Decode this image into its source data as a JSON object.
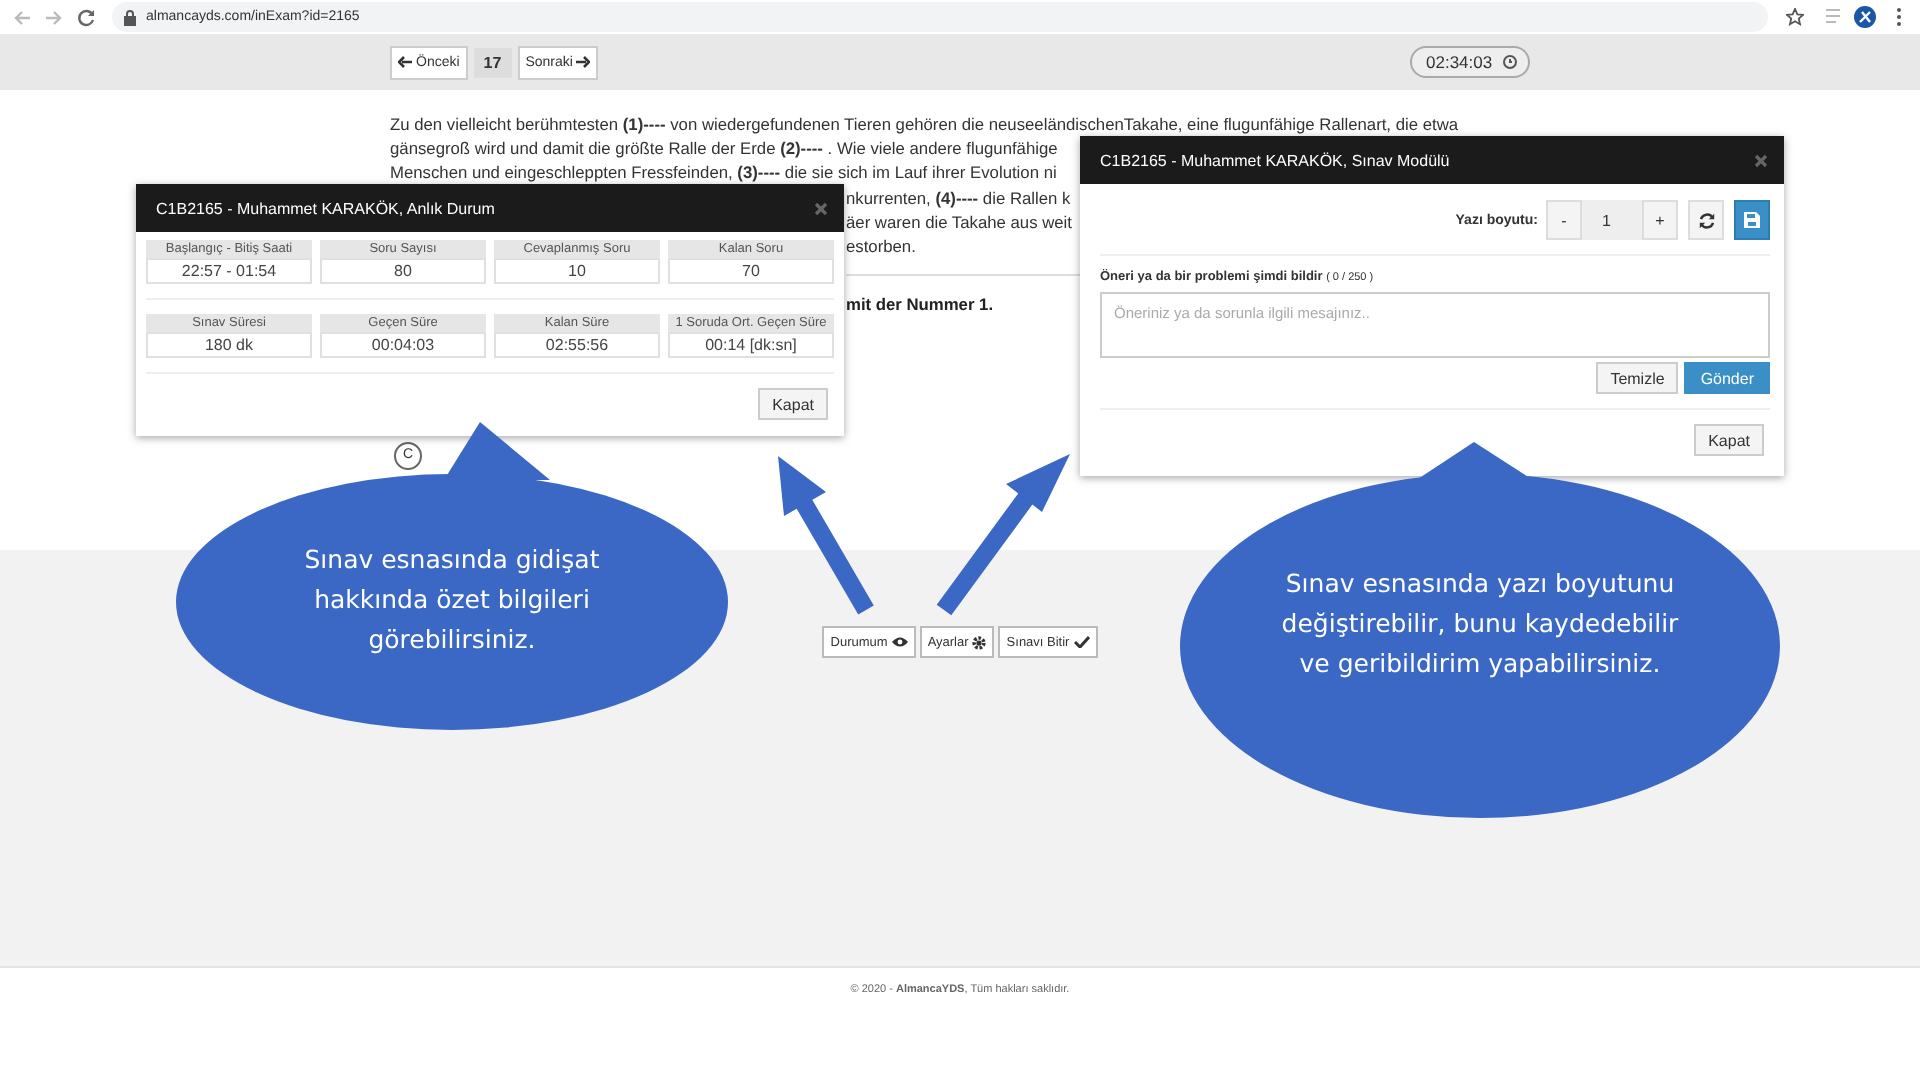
{
  "browser": {
    "url": "almancayds.com/inExam?id=2165"
  },
  "nav": {
    "prev": "Önceki",
    "question_number": "17",
    "next": "Sonraki",
    "timer": "02:34:03"
  },
  "passage": {
    "full_lines": [
      "Zu den vielleicht berühmtesten **(1)----** von wiedergefundenen Tieren gehören die neuseeländischenTakahe, eine flugunfähige Rallenart, die etwa",
      "gänsegroß wird und damit die größte Ralle der Erde **(2)----** . Wie viele andere flugunfähige",
      "Menschen und eingeschleppten Fressfeinden, **(3)----** die sie sich im Lauf ihrer Evolution ni"
    ],
    "right_fragments": [
      "nkurrenten, **(4)----** die Rallen k",
      "äer waren die Takahe aus weit",
      "estorben."
    ]
  },
  "question": "mit der Nummer 1.",
  "option": {
    "letter": "C"
  },
  "status_modal": {
    "title": "C1B2165 - Muhammet KARAKÖK, Anlık Durum",
    "rows": [
      [
        {
          "label": "Başlangıç - Bitiş Saati",
          "value": "22:57 - 01:54"
        },
        {
          "label": "Soru Sayısı",
          "value": "80"
        },
        {
          "label": "Cevaplanmış Soru",
          "value": "10"
        },
        {
          "label": "Kalan Soru",
          "value": "70"
        }
      ],
      [
        {
          "label": "Sınav Süresi",
          "value": "180 dk"
        },
        {
          "label": "Geçen Süre",
          "value": "00:04:03"
        },
        {
          "label": "Kalan Süre",
          "value": "02:55:56"
        },
        {
          "label": "1 Soruda Ort. Geçen Süre",
          "value": "00:14 [dk:sn]"
        }
      ]
    ],
    "close": "Kapat"
  },
  "settings_modal": {
    "title": "C1B2165 - Muhammet KARAKÖK, Sınav Modülü",
    "font_size_label": "Yazı boyutu:",
    "minus": "-",
    "font_size": "1",
    "plus": "+",
    "feedback_label": "Öneri ya da bir problemi şimdi bildir",
    "counter": "( 0 / 250 )",
    "placeholder": "Öneriniz ya da sorunla ilgili mesajınız..",
    "clear": "Temizle",
    "send": "Gönder",
    "close": "Kapat"
  },
  "actions": [
    {
      "label": "Durumum",
      "kind": "eye"
    },
    {
      "label": "Ayarlar",
      "kind": "gear"
    },
    {
      "label": "Sınavı Bitir",
      "kind": "check"
    }
  ],
  "callouts": [
    "Sınav esnasında gidişat hakkında özet bilgileri görebilirsiniz.",
    "Sınav esnasında yazı boyutunu değiştirebilir, bunu kaydedebilir ve geribildirim yapabilirsiniz."
  ],
  "footer": "© 2020 - **AlmancaYDS**, Tüm hakları saklıdır."
}
